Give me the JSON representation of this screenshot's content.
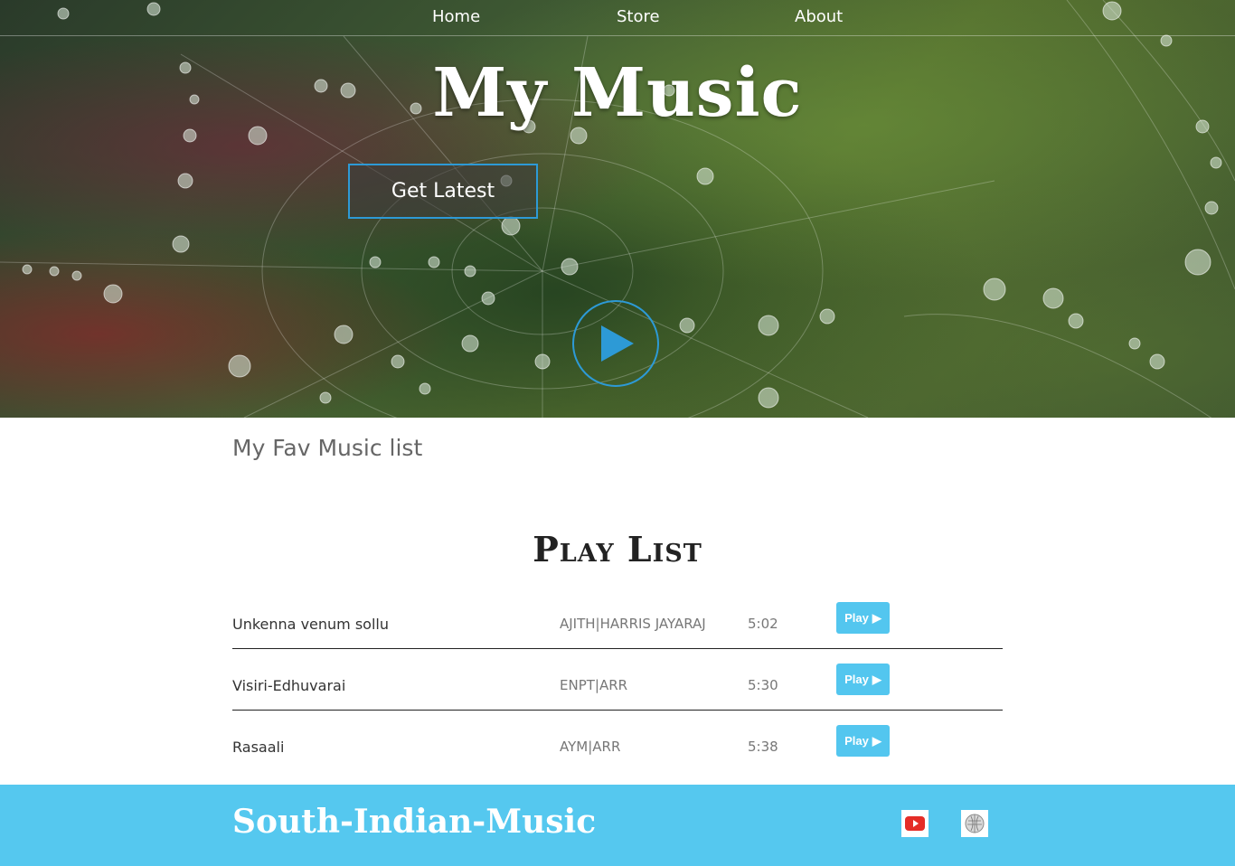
{
  "nav": {
    "items": [
      "Home",
      "Store",
      "About"
    ]
  },
  "hero": {
    "title": "My Music",
    "cta_label": "Get Latest",
    "play_icon": "play-icon"
  },
  "fav_heading": "My Fav Music list",
  "playlist": {
    "heading": "Play List",
    "tracks": [
      {
        "name": "Unkenna venum sollu",
        "artist": "AJITH|HARRIS JAYARAJ",
        "duration": "5:02",
        "button": "Play"
      },
      {
        "name": "Visiri-Edhuvarai",
        "artist": "ENPT|ARR",
        "duration": "5:30",
        "button": "Play"
      },
      {
        "name": "Rasaali",
        "artist": "AYM|ARR",
        "duration": "5:38",
        "button": "Play"
      }
    ]
  },
  "footer": {
    "brand": "South-Indian-Music",
    "icons": [
      "youtube-icon",
      "wikipedia-icon"
    ]
  },
  "colors": {
    "accent": "#2d9ad6",
    "button": "#53c6ef",
    "footer": "#55c8ef"
  }
}
